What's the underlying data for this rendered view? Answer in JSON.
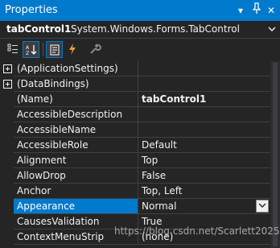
{
  "window": {
    "title": "Properties",
    "buttons": [
      "▾",
      "❘",
      "✕"
    ]
  },
  "object": {
    "name": "tabControl1",
    "type": "System.Windows.Forms.TabControl"
  },
  "properties": [
    {
      "name": "(ApplicationSettings)",
      "value": "",
      "expandable": true
    },
    {
      "name": "(DataBindings)",
      "value": "",
      "expandable": true
    },
    {
      "name": "(Name)",
      "value": "tabControl1",
      "bold": true
    },
    {
      "name": "AccessibleDescription",
      "value": ""
    },
    {
      "name": "AccessibleName",
      "value": ""
    },
    {
      "name": "AccessibleRole",
      "value": "Default"
    },
    {
      "name": "Alignment",
      "value": "Top"
    },
    {
      "name": "AllowDrop",
      "value": "False"
    },
    {
      "name": "Anchor",
      "value": "Top, Left"
    },
    {
      "name": "Appearance",
      "value": "Normal",
      "selected": true
    },
    {
      "name": "CausesValidation",
      "value": "True"
    },
    {
      "name": "ContextMenuStrip",
      "value": "(none)"
    }
  ],
  "watermark": "https://blog.csdn.net/Scarlett2025",
  "colors": {
    "accent": "#007acc",
    "background": "#252526"
  }
}
